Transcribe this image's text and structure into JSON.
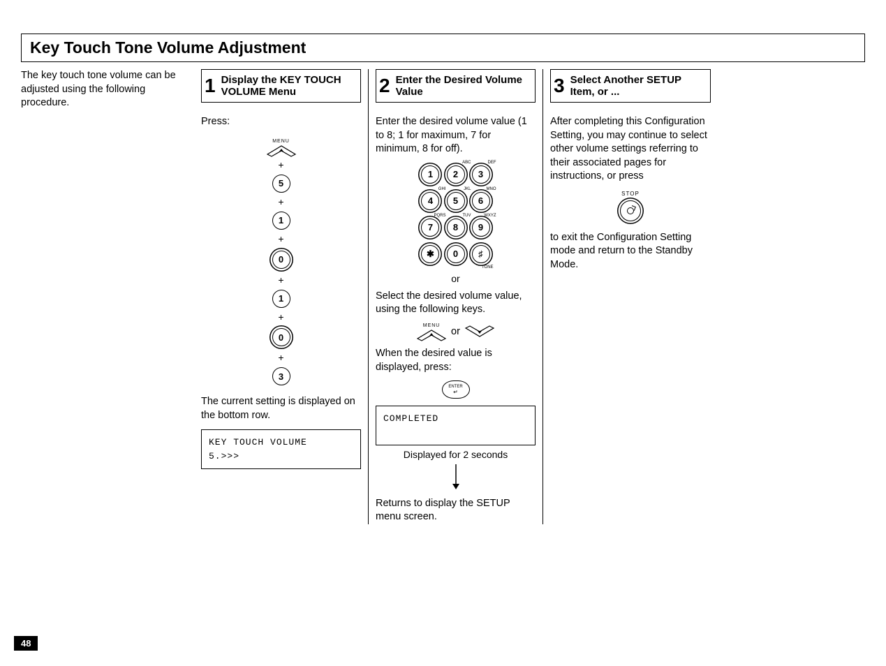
{
  "page": {
    "title": "Key Touch Tone Volume Adjustment",
    "number": "48"
  },
  "intro": "The key touch tone volume can be adjusted using the following procedure.",
  "step1": {
    "num": "1",
    "title": "Display the KEY TOUCH VOLUME Menu",
    "press_label": "Press:",
    "menu_label": "MENU",
    "seq": [
      "5",
      "1",
      "0",
      "1",
      "0",
      "3"
    ],
    "bottom_note": "The current setting is displayed on the bottom row.",
    "lcd_line1": "KEY TOUCH VOLUME",
    "lcd_line2": "5.>>>"
  },
  "step2": {
    "num": "2",
    "title": "Enter the Desired Volume Value",
    "instr": "Enter the desired volume value (1 to 8; 1 for maximum, 7 for minimum, 8 for off).",
    "keypad": {
      "r1": [
        "1",
        "2",
        "3"
      ],
      "r2": [
        "4",
        "5",
        "6"
      ],
      "r3": [
        "7",
        "8",
        "9"
      ],
      "r4": [
        "✱",
        "0",
        "♯"
      ],
      "sup": {
        "k2": "ABC",
        "k3": "DEF",
        "k4": "GHI",
        "k5": "JKL",
        "k6": "MNO",
        "k7": "PQRS",
        "k8": "TUV",
        "k9": "WXYZ"
      },
      "tone_label": "TONE"
    },
    "or": "or",
    "select_instr": "Select the desired volume value, using the following keys.",
    "menu_label": "MENU",
    "or2": "or",
    "when_instr": "When the desired value is displayed, press:",
    "enter_label": "ENTER",
    "lcd_completed": "COMPLETED",
    "disp2s": "Displayed for 2 seconds",
    "returns": "Returns to display the SETUP menu screen."
  },
  "step3": {
    "num": "3",
    "title": "Select Another SETUP Item, or ...",
    "para1": "After completing this Configuration Setting, you may continue to select other volume settings referring to their associated pages for instructions, or press",
    "stop_label": "STOP",
    "para2": "to exit the Configuration Setting mode and return to the Standby Mode."
  }
}
